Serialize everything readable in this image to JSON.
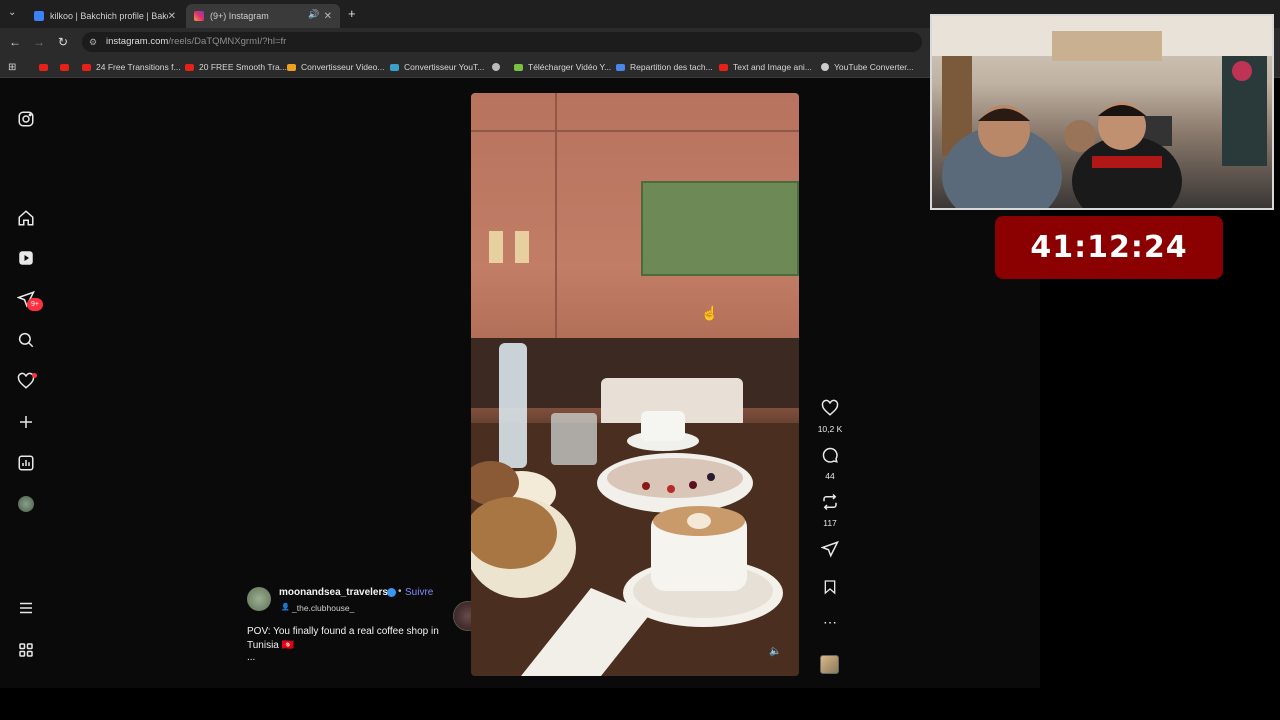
{
  "browser": {
    "tabs": [
      {
        "label": "kilkoo | Bakchich profile | Bakch",
        "active": false
      },
      {
        "label": "(9+) Instagram",
        "active": true
      }
    ],
    "url_host": "instagram.com",
    "url_rest": "/reels/DaTQMNXgrmI/?hl=fr",
    "bookmarks": [
      {
        "label": "",
        "color": "#e62117"
      },
      {
        "label": "",
        "color": "#e62117"
      },
      {
        "label": "24 Free Transitions f...",
        "color": "#e62117"
      },
      {
        "label": "20 FREE Smooth Tra...",
        "color": "#e62117"
      },
      {
        "label": "Convertisseur Video...",
        "color": "#f0a020"
      },
      {
        "label": "Convertisseur YouT...",
        "color": "#3aa0c8"
      },
      {
        "label": "",
        "color": "#bbbbbb"
      },
      {
        "label": "Télécharger Vidéo Y...",
        "color": "#7ac143"
      },
      {
        "label": "Repartition des tach...",
        "color": "#4a86e8"
      },
      {
        "label": "Text and Image ani...",
        "color": "#e62117"
      },
      {
        "label": "YouTube Converter...",
        "color": "#cccccc"
      }
    ]
  },
  "sidebar": {
    "notifications_badge": "9+"
  },
  "reel": {
    "username": "moonandsea_travelers",
    "follow_label": "Suivre",
    "audio_label": "_the.clubhouse_",
    "caption_line1": "POV: You finally found a real coffee shop in",
    "caption_line2": "Tunisia 🇹🇳",
    "caption_more": "...",
    "likes": "10,2 K",
    "comments": "44",
    "reposts": "117"
  },
  "stream": {
    "timer": "41:12:24"
  }
}
